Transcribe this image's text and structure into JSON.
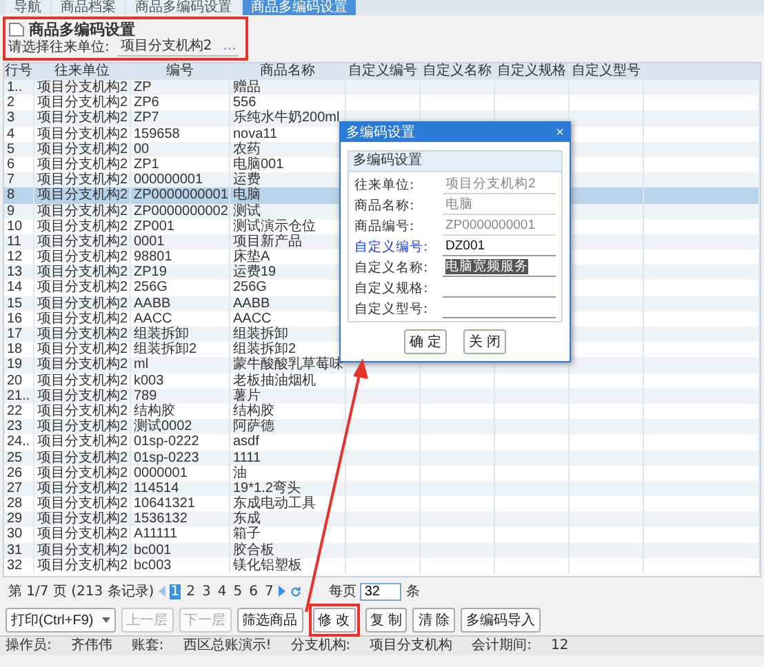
{
  "tabs": [
    {
      "label": "导航",
      "selected": false
    },
    {
      "label": "商品档案",
      "selected": false
    },
    {
      "label": "商品多编码设置",
      "selected": false
    },
    {
      "label": "商品多编码设置",
      "selected": true
    }
  ],
  "header": {
    "title": "商品多编码设置",
    "selector_label": "请选择往来单位:",
    "selector_value": "项目分支机构2",
    "selector_button": "...",
    "highlighted": true
  },
  "table": {
    "columns": [
      "行号",
      "往来单位",
      "编号",
      "商品名称",
      "自定义编号",
      "自定义名称",
      "自定义规格",
      "自定义型号"
    ],
    "rows": [
      {
        "cells": [
          "1..",
          "项目分支机构2",
          "ZP",
          "赠品"
        ],
        "selected": false
      },
      {
        "cells": [
          "2",
          "项目分支机构2",
          "ZP6",
          "556"
        ],
        "selected": false
      },
      {
        "cells": [
          "3",
          "项目分支机构2",
          "ZP7",
          "乐纯水牛奶200ml"
        ],
        "selected": false
      },
      {
        "cells": [
          "4",
          "项目分支机构2",
          "159658",
          "nova11"
        ],
        "selected": false
      },
      {
        "cells": [
          "5",
          "项目分支机构2",
          "00",
          "农药"
        ],
        "selected": false
      },
      {
        "cells": [
          "6",
          "项目分支机构2",
          "ZP1",
          "电脑001"
        ],
        "selected": false
      },
      {
        "cells": [
          "7",
          "项目分支机构2",
          "000000001",
          "运费"
        ],
        "selected": false
      },
      {
        "cells": [
          "8",
          "项目分支机构2",
          "ZP0000000001",
          "电脑"
        ],
        "selected": true
      },
      {
        "cells": [
          "9",
          "项目分支机构2",
          "ZP0000000002",
          "测试"
        ],
        "selected": false
      },
      {
        "cells": [
          "10",
          "项目分支机构2",
          "ZP001",
          "测试演示仓位"
        ],
        "selected": false
      },
      {
        "cells": [
          "11",
          "项目分支机构2",
          "0001",
          "项目新产品"
        ],
        "selected": false
      },
      {
        "cells": [
          "12",
          "项目分支机构2",
          "98801",
          "床垫A"
        ],
        "selected": false
      },
      {
        "cells": [
          "13",
          "项目分支机构2",
          "ZP19",
          "运费19"
        ],
        "selected": false
      },
      {
        "cells": [
          "14",
          "项目分支机构2",
          "256G",
          "256G"
        ],
        "selected": false
      },
      {
        "cells": [
          "15",
          "项目分支机构2",
          "AABB",
          "AABB"
        ],
        "selected": false
      },
      {
        "cells": [
          "16",
          "项目分支机构2",
          "AACC",
          "AACC"
        ],
        "selected": false
      },
      {
        "cells": [
          "17",
          "项目分支机构2",
          "组装拆卸",
          "组装拆卸"
        ],
        "selected": false
      },
      {
        "cells": [
          "18",
          "项目分支机构2",
          "组装拆卸2",
          "组装拆卸2"
        ],
        "selected": false
      },
      {
        "cells": [
          "19",
          "项目分支机构2",
          "ml",
          "蒙牛酸酸乳草莓味"
        ],
        "selected": false
      },
      {
        "cells": [
          "20",
          "项目分支机构2",
          "k003",
          "老板抽油烟机"
        ],
        "selected": false
      },
      {
        "cells": [
          "21..",
          "项目分支机构2",
          "789",
          "薯片"
        ],
        "selected": false
      },
      {
        "cells": [
          "22",
          "项目分支机构2",
          "结构胶",
          "结构胶"
        ],
        "selected": false
      },
      {
        "cells": [
          "23",
          "项目分支机构2",
          "测试0002",
          "阿萨德"
        ],
        "selected": false
      },
      {
        "cells": [
          "24..",
          "项目分支机构2",
          "01sp-0222",
          "asdf"
        ],
        "selected": false
      },
      {
        "cells": [
          "25",
          "项目分支机构2",
          "01sp-0223",
          "1111"
        ],
        "selected": false
      },
      {
        "cells": [
          "26",
          "项目分支机构2",
          "0000001",
          "油"
        ],
        "selected": false
      },
      {
        "cells": [
          "27",
          "项目分支机构2",
          "114514",
          "19*1.2弯头"
        ],
        "selected": false
      },
      {
        "cells": [
          "28",
          "项目分支机构2",
          "10641321",
          "东成电动工具"
        ],
        "selected": false
      },
      {
        "cells": [
          "29",
          "项目分支机构2",
          "1536132",
          "东成"
        ],
        "selected": false
      },
      {
        "cells": [
          "30",
          "项目分支机构2",
          "A11111",
          "箱子"
        ],
        "selected": false
      },
      {
        "cells": [
          "31",
          "项目分支机构2",
          "bc001",
          "胶合板"
        ],
        "selected": false
      },
      {
        "cells": [
          "32",
          "项目分支机构2",
          "bc003",
          "镁化铝塑板"
        ],
        "selected": false
      }
    ]
  },
  "pagination": {
    "summary": "第 1/7 页 (213 条记录)",
    "pages": [
      {
        "label": "1",
        "selected": true
      },
      {
        "label": "2",
        "selected": false
      },
      {
        "label": "3",
        "selected": false
      },
      {
        "label": "4",
        "selected": false
      },
      {
        "label": "5",
        "selected": false
      },
      {
        "label": "6",
        "selected": false
      },
      {
        "label": "7",
        "selected": false
      }
    ],
    "per_page_label": "每页",
    "per_page": "32",
    "per_page_unit": "条"
  },
  "toolbar": [
    {
      "kind": "dropdown",
      "label": "打印(Ctrl+F9)",
      "disabled": false,
      "highlighted": false
    },
    {
      "kind": "button",
      "label": "上一层",
      "disabled": true,
      "highlighted": false
    },
    {
      "kind": "button",
      "label": "下一层",
      "disabled": true,
      "highlighted": false
    },
    {
      "kind": "button",
      "label": "筛选商品",
      "disabled": false,
      "highlighted": false
    },
    {
      "kind": "button",
      "label": "修 改",
      "disabled": false,
      "highlighted": true
    },
    {
      "kind": "button",
      "label": "复 制",
      "disabled": false,
      "highlighted": false
    },
    {
      "kind": "button",
      "label": "清 除",
      "disabled": false,
      "highlighted": false
    },
    {
      "kind": "button",
      "label": "多编码导入",
      "disabled": false,
      "highlighted": false
    }
  ],
  "status_bar": [
    {
      "label": "操作员:",
      "value": "齐伟伟"
    },
    {
      "label": "账套:",
      "value": "西区总账演示!"
    },
    {
      "label": "分支机构:",
      "value": "项目分支机构"
    },
    {
      "label": "会计期间:",
      "value": "12"
    }
  ],
  "dialog": {
    "title": "多编码设置",
    "close": "×",
    "section": "多编码设置",
    "fields": [
      {
        "label": "往来单位:",
        "value": "项目分支机构2",
        "readonly": true,
        "required": false,
        "text_selected": false
      },
      {
        "label": "商品名称:",
        "value": "电脑",
        "readonly": true,
        "required": false,
        "text_selected": false
      },
      {
        "label": "商品编号:",
        "value": "ZP0000000001",
        "readonly": true,
        "required": false,
        "text_selected": false
      },
      {
        "label": "自定义编号:",
        "value": "DZ001",
        "readonly": false,
        "required": true,
        "text_selected": false
      },
      {
        "label": "自定义名称:",
        "value": "电脑宽频服务",
        "readonly": false,
        "required": false,
        "text_selected": true
      },
      {
        "label": "自定义规格:",
        "readonly": false,
        "required": false
      },
      {
        "label": "自定义型号:",
        "readonly": false,
        "required": false
      }
    ],
    "buttons": [
      "确 定",
      "关 闭"
    ]
  }
}
